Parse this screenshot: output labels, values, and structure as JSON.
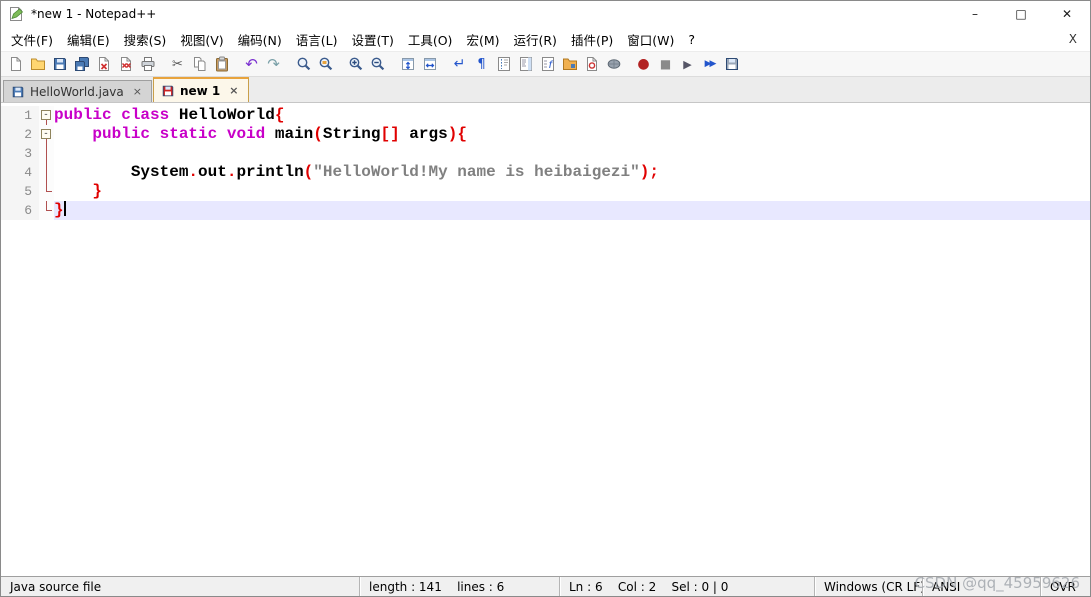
{
  "window": {
    "title": "*new 1 - Notepad++",
    "controls": {
      "minimize": "–",
      "maximize": "□",
      "close": "✕"
    }
  },
  "menu": {
    "items": [
      {
        "id": "file",
        "label": "文件(F)"
      },
      {
        "id": "edit",
        "label": "编辑(E)"
      },
      {
        "id": "search",
        "label": "搜索(S)"
      },
      {
        "id": "view",
        "label": "视图(V)"
      },
      {
        "id": "encoding",
        "label": "编码(N)"
      },
      {
        "id": "language",
        "label": "语言(L)"
      },
      {
        "id": "settings",
        "label": "设置(T)"
      },
      {
        "id": "tools",
        "label": "工具(O)"
      },
      {
        "id": "macro",
        "label": "宏(M)"
      },
      {
        "id": "run",
        "label": "运行(R)"
      },
      {
        "id": "plugins",
        "label": "插件(P)"
      },
      {
        "id": "window",
        "label": "窗口(W)"
      },
      {
        "id": "help",
        "label": "?"
      }
    ],
    "close_doc": "X"
  },
  "toolbar": {
    "icons": [
      {
        "name": "new-file",
        "kind": "page"
      },
      {
        "name": "open",
        "kind": "folder"
      },
      {
        "name": "save",
        "kind": "floppy"
      },
      {
        "name": "save-all",
        "kind": "floppy-all"
      },
      {
        "name": "close",
        "kind": "page-close"
      },
      {
        "name": "close-all",
        "kind": "page-close-all"
      },
      {
        "name": "print",
        "kind": "printer"
      },
      {
        "name": "cut",
        "kind": "scissors",
        "sep": true
      },
      {
        "name": "copy",
        "kind": "copy"
      },
      {
        "name": "paste",
        "kind": "clipboard"
      },
      {
        "name": "undo",
        "kind": "undo",
        "sep": true
      },
      {
        "name": "redo",
        "kind": "redo"
      },
      {
        "name": "find",
        "kind": "magnifier",
        "sep": true
      },
      {
        "name": "replace",
        "kind": "magnifier-replace"
      },
      {
        "name": "zoom-in",
        "kind": "magnifier-plus",
        "sep": true
      },
      {
        "name": "zoom-out",
        "kind": "magnifier-minus"
      },
      {
        "name": "sync-vertical-scrolling",
        "kind": "win-sync-v",
        "sep": true
      },
      {
        "name": "sync-horizontal-scrolling",
        "kind": "win-sync-h"
      },
      {
        "name": "word-wrap",
        "kind": "wrap",
        "sep": true
      },
      {
        "name": "show-all-characters",
        "kind": "pilcrow"
      },
      {
        "name": "indent-guide",
        "kind": "indent-guide"
      },
      {
        "name": "document-map",
        "kind": "doc-map"
      },
      {
        "name": "function-list",
        "kind": "func-list"
      },
      {
        "name": "folder-as-workspace",
        "kind": "folder-ws"
      },
      {
        "name": "file-monitoring",
        "kind": "file-monitor"
      },
      {
        "name": "document-peek",
        "kind": "browser-view"
      },
      {
        "name": "macro-record",
        "kind": "record",
        "sep": true
      },
      {
        "name": "macro-stop",
        "kind": "stop"
      },
      {
        "name": "macro-play",
        "kind": "play"
      },
      {
        "name": "macro-run-multiple",
        "kind": "play-multi"
      },
      {
        "name": "macro-save",
        "kind": "floppy-gray"
      }
    ]
  },
  "tabs": [
    {
      "id": "helloworld-java",
      "label": "HelloWorld.java",
      "modified": false,
      "active": false
    },
    {
      "id": "new-1",
      "label": "new 1",
      "modified": true,
      "active": true
    }
  ],
  "tab_close_glyph": "×",
  "editor": {
    "language": "Java",
    "current_line": 6,
    "caret": {
      "line": 6,
      "col": 2
    },
    "lines": [
      {
        "num": 1,
        "fold": "box",
        "tokens": [
          [
            "kw",
            "public"
          ],
          [
            "pl",
            " "
          ],
          [
            "kw",
            "class"
          ],
          [
            "pl",
            " "
          ],
          [
            "id",
            "HelloWorld"
          ],
          [
            "op",
            "{"
          ]
        ]
      },
      {
        "num": 2,
        "fold": "box",
        "tokens": [
          [
            "pl",
            "    "
          ],
          [
            "kw",
            "public"
          ],
          [
            "pl",
            " "
          ],
          [
            "kw",
            "static"
          ],
          [
            "pl",
            " "
          ],
          [
            "kw",
            "void"
          ],
          [
            "pl",
            " "
          ],
          [
            "id",
            "main"
          ],
          [
            "op",
            "("
          ],
          [
            "id",
            "String"
          ],
          [
            "op",
            "[]"
          ],
          [
            "pl",
            " "
          ],
          [
            "id",
            "args"
          ],
          [
            "op",
            ")"
          ],
          [
            "op",
            "{"
          ]
        ]
      },
      {
        "num": 3,
        "fold": "vline",
        "tokens": []
      },
      {
        "num": 4,
        "fold": "vline",
        "tokens": [
          [
            "pl",
            "        "
          ],
          [
            "id",
            "System"
          ],
          [
            "op",
            "."
          ],
          [
            "id",
            "out"
          ],
          [
            "op",
            "."
          ],
          [
            "id",
            "println"
          ],
          [
            "op",
            "("
          ],
          [
            "str",
            "\"HelloWorld!My name is heibaigezi\""
          ],
          [
            "op",
            ")"
          ],
          [
            "op",
            ";"
          ]
        ]
      },
      {
        "num": 5,
        "fold": "corner",
        "tokens": [
          [
            "pl",
            "    "
          ],
          [
            "op",
            "}"
          ]
        ]
      },
      {
        "num": 6,
        "fold": "corner",
        "tokens": [
          [
            "op",
            "}"
          ]
        ]
      }
    ]
  },
  "status_bar": {
    "doc_type": "Java source file",
    "length_lines": "length : 141    lines : 6",
    "position": "Ln : 6    Col : 2    Sel : 0 | 0",
    "eol": "Windows (CR LF)",
    "encoding": "ANSI",
    "mode": "OVR"
  },
  "watermark": "CSDN @qq_45959626",
  "colors": {
    "kw": "#c800c8",
    "id": "#000000",
    "op": "#e00000",
    "str": "#808080",
    "lnum": "#8a8a8a",
    "curline": "#e8e8ff",
    "fold": "#b05050",
    "tab_accent": "#e8a33d",
    "tab_modified": "#cc2222",
    "tab_saved": "#4a7ab5"
  }
}
